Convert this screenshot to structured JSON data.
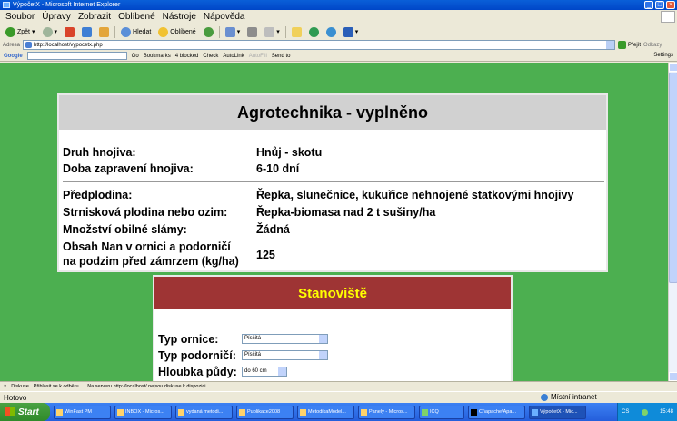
{
  "window": {
    "title": "VýpočetX - Microsoft Internet Explorer"
  },
  "menu": [
    "Soubor",
    "Úpravy",
    "Zobrazit",
    "Oblíbené",
    "Nástroje",
    "Nápověda"
  ],
  "toolbar": {
    "back": "Zpět",
    "search": "Hledat",
    "favorites": "Oblíbené"
  },
  "address": {
    "label": "Adresa",
    "url": "http://localhost/vypocetx.php",
    "go": "Přejít",
    "links": "Odkazy"
  },
  "google": {
    "logo": "Google",
    "go": "Go",
    "bookmarks": "Bookmarks",
    "blocked": "4 blocked",
    "check": "Check",
    "autolink": "AutoLink",
    "autofill": "AutoFill",
    "sendto": "Send to",
    "settings": "Settings"
  },
  "agro": {
    "title": "Agrotechnika - vyplněno",
    "rows": [
      {
        "label": "Druh hnojiva:",
        "value": "Hnůj - skotu"
      },
      {
        "label": "Doba zapravení hnojiva:",
        "value": "6-10 dní"
      },
      {
        "label": "Předplodina:",
        "value": "Řepka, slunečnice, kukuřice nehnojené statkovými hnojivy"
      },
      {
        "label": "Strnisková plodina nebo ozim:",
        "value": "Řepka-biomasa nad 2 t sušiny/ha"
      },
      {
        "label": "Množství obilné slámy:",
        "value": "Žádná"
      },
      {
        "label": "Obsah Nan v ornici a podorničí",
        "label2": "na podzim před zámrzem (kg/ha)",
        "value": "125"
      }
    ]
  },
  "stanoviste": {
    "title": "Stanoviště",
    "fields": [
      {
        "label": "Typ ornice:",
        "value": "Písčitá"
      },
      {
        "label": "Typ podorničí:",
        "value": "Písčitá"
      },
      {
        "label": "Hloubka půdy:",
        "value": "do 60 cm"
      }
    ]
  },
  "discuss": {
    "label": "Diskuse",
    "subscribe": "Přihlásit se k odběru...",
    "message": "Na serveru http://localhost/ nejsou diskuse k dispozici."
  },
  "status": {
    "text": "Hotovo",
    "zone": "Místní intranet"
  },
  "taskbar": {
    "start": "Start",
    "tasks": [
      "WinFast PM",
      "INBOX - Micros...",
      "vydaná metodi...",
      "Publikace2008",
      "MetodikaModel...",
      "Panely - Micros...",
      "ICQ",
      "C:\\apache\\Apa...",
      "VýpočetX - Mic..."
    ],
    "lang": "CS",
    "clock": "15:48"
  }
}
